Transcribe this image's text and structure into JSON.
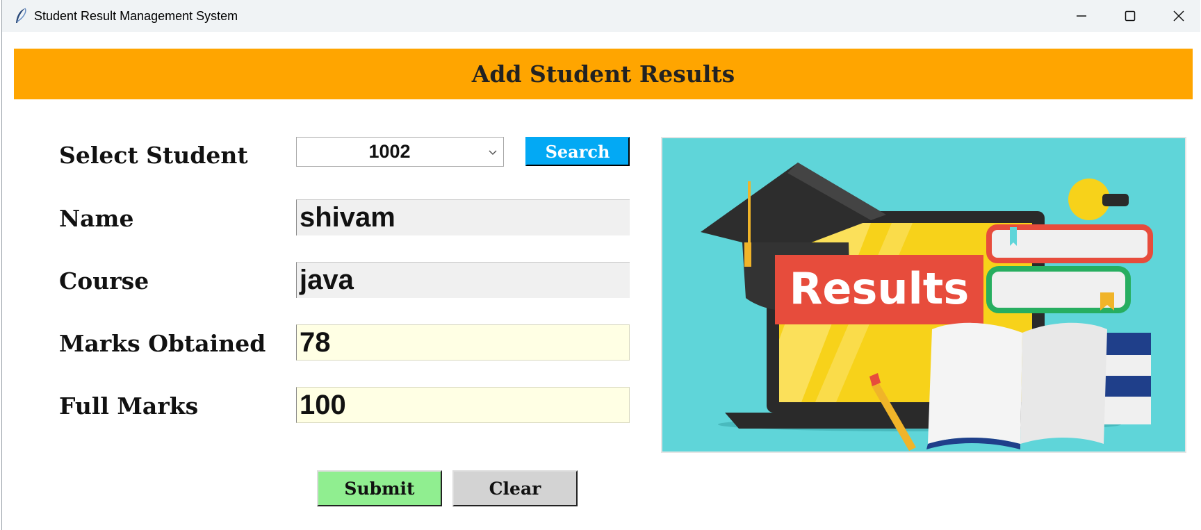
{
  "window": {
    "title": "Student Result Management System",
    "icons": {
      "app": "feather-icon",
      "minimize": "minimize-icon",
      "maximize": "maximize-icon",
      "close": "close-icon"
    }
  },
  "header": {
    "title": "Add Student Results"
  },
  "form": {
    "select_student_label": "Select Student",
    "selected_student": "1002",
    "search_label": "Search",
    "name_label": "Name",
    "name_value": "shivam",
    "course_label": "Course",
    "course_value": "java",
    "marks_obtained_label": "Marks Obtained",
    "marks_obtained_value": "78",
    "full_marks_label": "Full Marks",
    "full_marks_value": "100"
  },
  "actions": {
    "submit_label": "Submit",
    "clear_label": "Clear"
  },
  "illustration": {
    "text": "Results"
  },
  "colors": {
    "header_bg": "#ffa500",
    "search_bg": "#03a9f4",
    "submit_bg": "#90ee90",
    "clear_bg": "#d3d3d3",
    "editable_bg": "#ffffe4",
    "readonly_bg": "#f0f0f0",
    "illustration_bg": "#5fd5d9"
  }
}
